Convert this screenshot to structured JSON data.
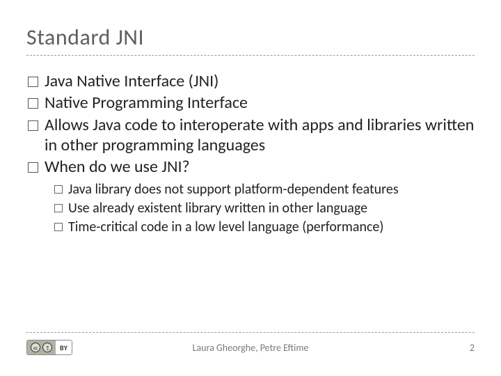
{
  "title": "Standard JNI",
  "bullets": [
    {
      "text": "Java Native Interface (JNI)"
    },
    {
      "text": "Native Programming Interface"
    },
    {
      "text": "Allows Java code to interoperate with apps and libraries written in other programming languages"
    },
    {
      "text": "When do we use JNI?"
    }
  ],
  "sub_bullets": [
    {
      "text": "Java library does not support platform-dependent features"
    },
    {
      "text": "Use already existent library written in other language"
    },
    {
      "text": "Time-critical code in a low level language (performance)"
    }
  ],
  "footer": {
    "license_short": "BY",
    "cc_label": "cc",
    "person_glyph": "👤",
    "authors": "Laura Gheorghe, Petre Eftime",
    "page": "2"
  }
}
